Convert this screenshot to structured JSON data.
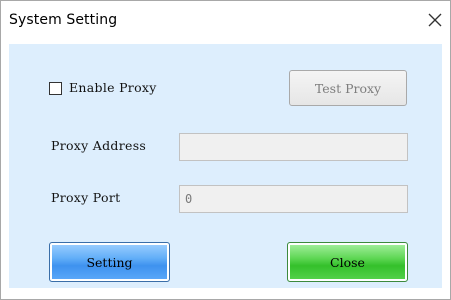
{
  "window": {
    "title": "System Setting",
    "close_icon": "close-icon"
  },
  "proxy": {
    "enable_label": "Enable Proxy",
    "enabled": false,
    "test_button_label": "Test Proxy",
    "address_label": "Proxy Address",
    "address_value": "",
    "port_label": "Proxy Port",
    "port_value": "0"
  },
  "actions": {
    "setting_label": "Setting",
    "close_label": "Close"
  },
  "colors": {
    "content_bg": "#ddeefd",
    "setting_button": "#4a9ef5",
    "close_button": "#3ec535",
    "disabled_text": "#7d7d7d"
  }
}
